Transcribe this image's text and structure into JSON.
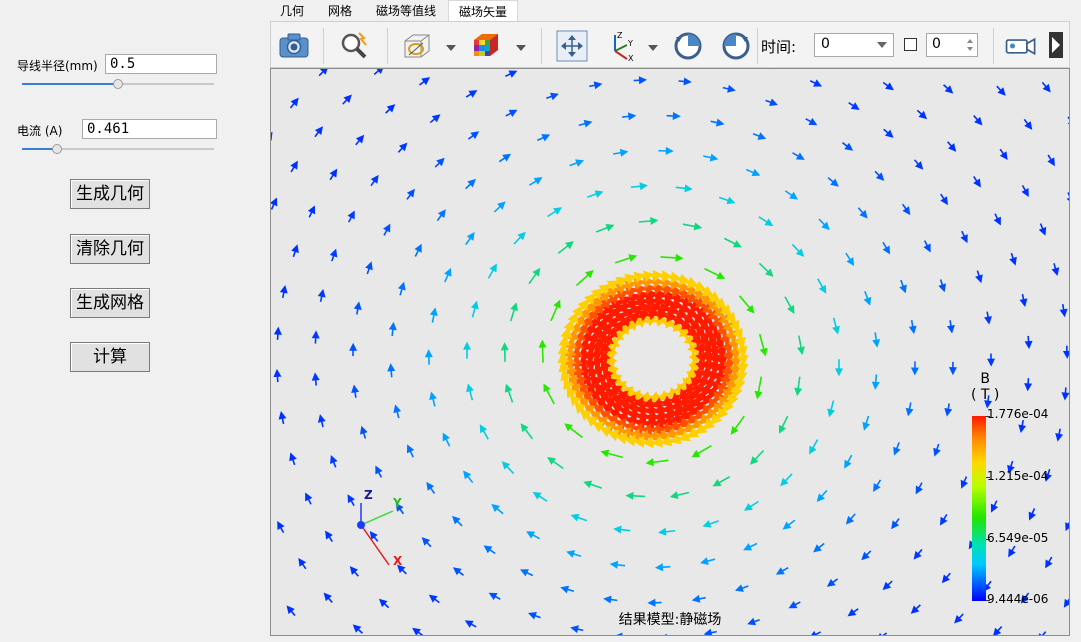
{
  "left_panel": {
    "radius_label": "导线半径(mm)",
    "radius_value": "0.5",
    "radius_slider": 0.5,
    "current_label": "电流 (A)",
    "current_value": "0.461",
    "current_slider": 0.18,
    "buttons": {
      "generate_geometry": "生成几何",
      "clear_geometry": "清除几何",
      "generate_mesh": "生成网格",
      "compute": "计算"
    }
  },
  "tabs": [
    {
      "label": "几何",
      "active": false
    },
    {
      "label": "网格",
      "active": false
    },
    {
      "label": "磁场等值线",
      "active": false
    },
    {
      "label": "磁场矢量",
      "active": true
    }
  ],
  "toolbar": {
    "icons": [
      "camera-icon",
      "zoom-fit-icon",
      "box-view-icon",
      "color-cube-icon",
      "pan-icon",
      "axes-icon",
      "rotate-cw-icon",
      "rotate-ccw-icon",
      "video-camera-icon"
    ],
    "time_label": "时间:",
    "time_value": "0",
    "step_value": "0"
  },
  "viewport": {
    "caption": "结果模型:静磁场",
    "legend": {
      "title": "B",
      "unit": "( T )",
      "ticks": [
        "1.776e-04",
        "1.215e-04",
        "6.549e-05",
        "9.444e-06"
      ]
    },
    "axes_labels": {
      "z": "Z",
      "y": "Y",
      "x": "X"
    }
  },
  "colors": {
    "field_high": "#ff1a00",
    "field_mid": "#20e600",
    "field_low": "#00c8ff",
    "accent": "#3b7fd4"
  }
}
